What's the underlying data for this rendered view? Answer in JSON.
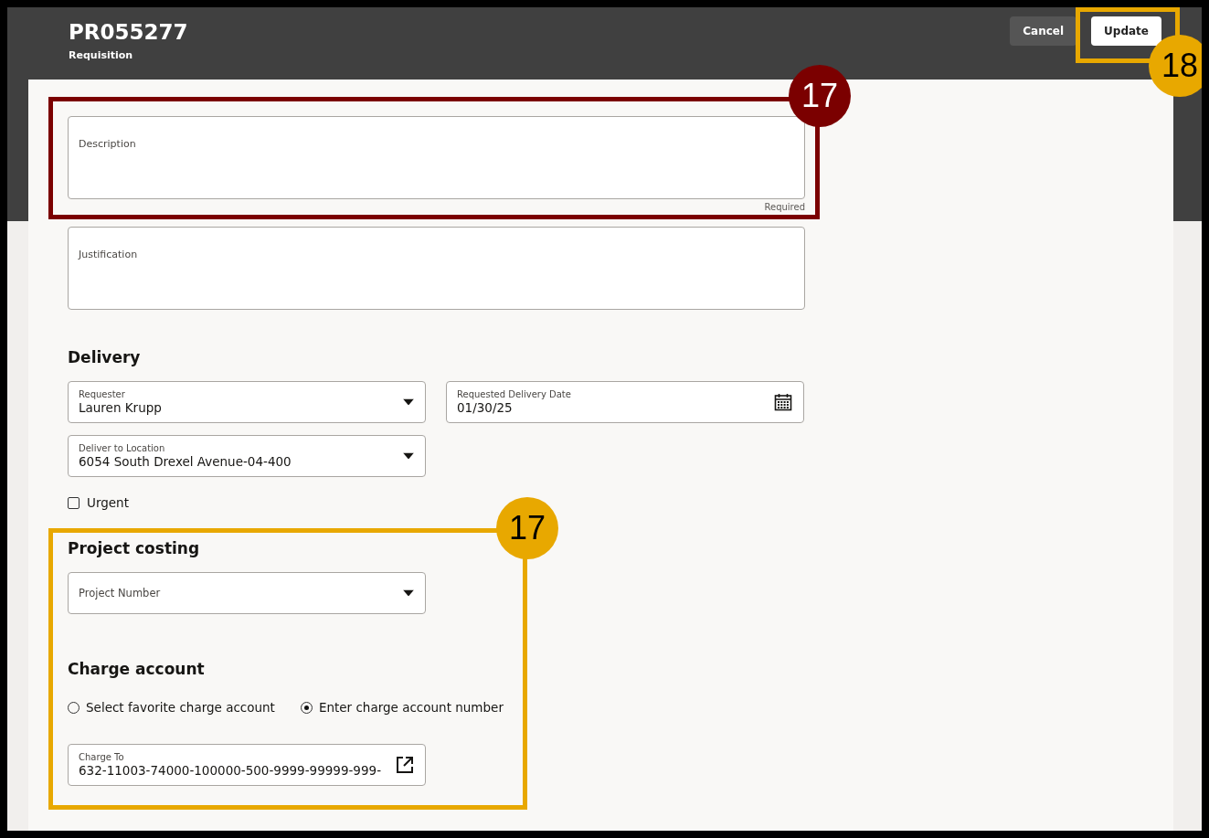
{
  "header": {
    "title": "PR055277",
    "subtitle": "Requisition",
    "buttons": [
      {
        "label": "Cancel",
        "kind": "secondary"
      },
      {
        "label": "Update",
        "kind": "primary",
        "callout": {
          "number": "18",
          "color": "#e8a800"
        }
      }
    ]
  },
  "description": {
    "label": "Description",
    "hint": "Required",
    "callout": {
      "number": "17",
      "color": "#7b0000"
    }
  },
  "justification": {
    "label": "Justification"
  },
  "delivery": {
    "heading": "Delivery",
    "fields": [
      {
        "label": "Requester",
        "value": "Lauren Krupp",
        "kind": "select"
      },
      {
        "label": "Requested Delivery Date",
        "value": "01/30/25",
        "kind": "date"
      },
      {
        "label": "Deliver to Location",
        "value": "6054 South Drexel Avenue-04-400",
        "kind": "select"
      }
    ],
    "urgent": {
      "label": "Urgent",
      "checked": false
    }
  },
  "project_costing": {
    "heading": "Project costing",
    "callout": {
      "number": "17",
      "color": "#e8a800"
    },
    "field": {
      "label": "Project Number",
      "kind": "select"
    }
  },
  "charge_account": {
    "heading": "Charge account",
    "options": [
      {
        "label": "Select favorite charge account",
        "selected": false
      },
      {
        "label": "Enter charge account number",
        "selected": true
      }
    ],
    "field": {
      "label": "Charge To",
      "value": "632-11003-74000-100000-500-9999-99999-999-",
      "kind": "link"
    }
  }
}
